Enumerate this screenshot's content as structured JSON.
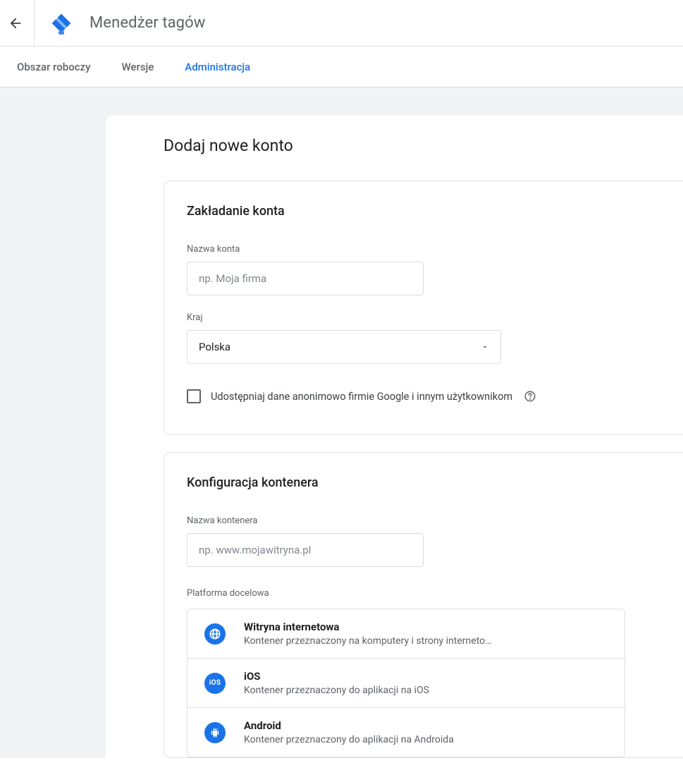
{
  "header": {
    "app_title": "Menedżer tagów"
  },
  "tabs": {
    "workspace": "Obszar roboczy",
    "versions": "Wersje",
    "admin": "Administracja"
  },
  "page": {
    "title": "Dodaj nowe konto"
  },
  "account": {
    "section_title": "Zakładanie konta",
    "name_label": "Nazwa konta",
    "name_placeholder": "np. Moja firma",
    "country_label": "Kraj",
    "country_value": "Polska",
    "share_anon_label": "Udostępniaj dane anonimowo firmie Google i innym użytkownikom"
  },
  "container": {
    "section_title": "Konfiguracja kontenera",
    "name_label": "Nazwa kontenera",
    "name_placeholder": "np. www.mojawitryna.pl",
    "platform_label": "Platforma docelowa",
    "platforms": [
      {
        "title": "Witryna internetowa",
        "desc": "Kontener przeznaczony na komputery i strony interneto…"
      },
      {
        "title": "iOS",
        "desc": "Kontener przeznaczony do aplikacji na iOS"
      },
      {
        "title": "Android",
        "desc": "Kontener przeznaczony do aplikacji na Androida"
      }
    ]
  }
}
